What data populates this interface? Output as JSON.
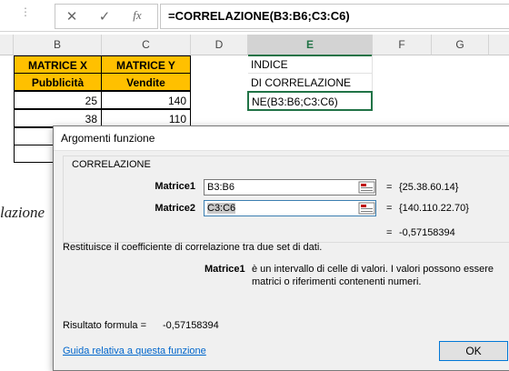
{
  "formula_bar": {
    "cancel_symbol": "✕",
    "enter_symbol": "✓",
    "fx_symbol": "fx",
    "formula": "=CORRELAZIONE(B3:B6;C3:C6)"
  },
  "columns": [
    "B",
    "C",
    "D",
    "E",
    "F",
    "G"
  ],
  "selected_column": "E",
  "sheet": {
    "b1": "MATRICE X",
    "c1": "MATRICE Y",
    "b2": "Pubblicità",
    "c2": "Vendite",
    "b3": "25",
    "c3": "140",
    "b4": "38",
    "c4": "110",
    "e1": "INDICE",
    "e2": "DI CORRELAZIONE",
    "e3": "NE(B3:B6;C3:C6)"
  },
  "background_text": "lazione",
  "dialog": {
    "title": "Argomenti funzione",
    "function_name": "CORRELAZIONE",
    "arg1_label": "Matrice1",
    "arg1_value": "B3:B6",
    "arg1_result": "{25.38.60.14}",
    "arg2_label": "Matrice2",
    "arg2_value": "C3:C6",
    "arg2_result": "{140.110.22.70}",
    "equals": "=",
    "function_result": "-0,57158394",
    "description": "Restituisce il coefficiente di correlazione tra due set di dati.",
    "arg_help_label": "Matrice1",
    "arg_help_text_1": "è un intervallo di celle di valori. I valori possono essere",
    "arg_help_text_2": "matrici o riferimenti contenenti numeri.",
    "result_label": "Risultato formula =",
    "result_value": "-0,57158394",
    "help_link": "Guida relativa a questa funzione",
    "ok_label": "OK"
  },
  "colors": {
    "header_yellow": "#ffc000",
    "excel_green": "#217346",
    "link_blue": "#0066cc"
  }
}
